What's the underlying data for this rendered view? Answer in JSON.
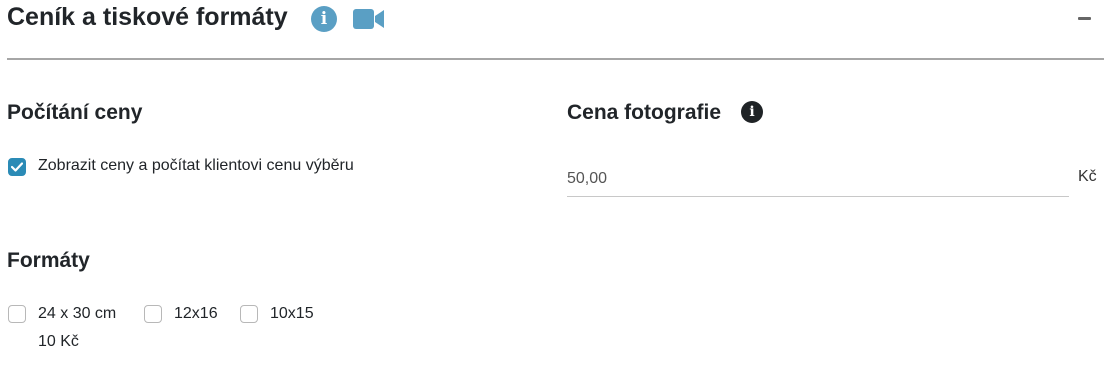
{
  "header": {
    "title": "Ceník a tiskové formáty",
    "info_icon": "info-circle-icon",
    "video_icon": "video-camera-icon",
    "collapse_icon": "minus-icon",
    "accent": "#5a9fc4"
  },
  "pricing": {
    "heading": "Počítání ceny",
    "show_prices_label": "Zobrazit ceny a počítat klientovi cenu výběru",
    "show_prices_checked": true
  },
  "photo_price": {
    "heading": "Cena fotografie",
    "value": "50,00",
    "currency": "Kč"
  },
  "formats": {
    "heading": "Formáty",
    "items": [
      {
        "label": "24 x 30 cm",
        "price": "10 Kč",
        "checked": false
      },
      {
        "label": "12x16",
        "checked": false
      },
      {
        "label": "10x15",
        "checked": false
      }
    ]
  },
  "colors": {
    "checkbox_checked": "#2b8bb6",
    "text": "#212529"
  }
}
